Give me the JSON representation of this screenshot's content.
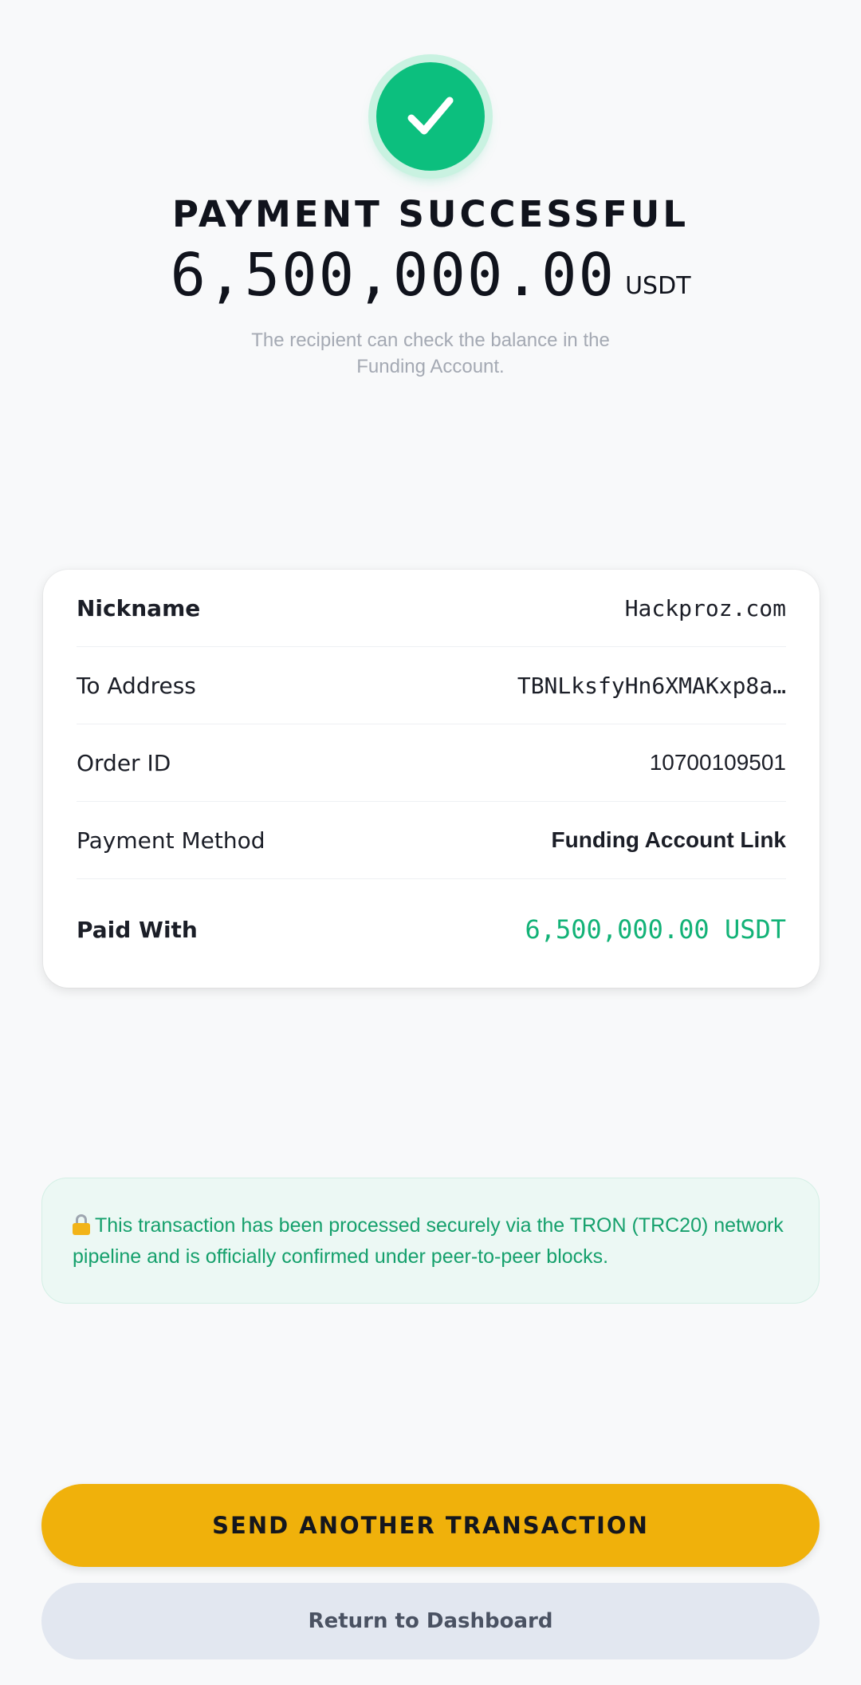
{
  "header": {
    "icon": "checkmark-icon",
    "title": "PAYMENT SUCCESSFUL",
    "amount": "6,500,000.00",
    "currency": "USDT",
    "subtitle": "The recipient can check the balance in the Funding Account."
  },
  "details": {
    "rows": [
      {
        "label": "Nickname",
        "value": "Hackproz.com"
      },
      {
        "label": "To Address",
        "value": "TBNLksfyHn6XMAKxp8a…"
      },
      {
        "label": "Order ID",
        "value": "10700109501"
      },
      {
        "label": "Payment Method",
        "value": "Funding Account Link"
      },
      {
        "label": "Paid With",
        "value": "6,500,000.00 USDT"
      }
    ]
  },
  "notice": {
    "icon": "lock-icon",
    "text": "This transaction has been processed securely via the TRON (TRC20) network pipeline and is officially confirmed under peer-to-peer blocks."
  },
  "actions": {
    "primary_label": "SEND ANOTHER TRANSACTION",
    "secondary_label": "Return to Dashboard"
  },
  "colors": {
    "background": "#f8f9fa",
    "success": "#0cbf7e",
    "accent_green": "#12b277",
    "primary_button": "#f0b10b",
    "secondary_button": "#e2e7f0"
  }
}
